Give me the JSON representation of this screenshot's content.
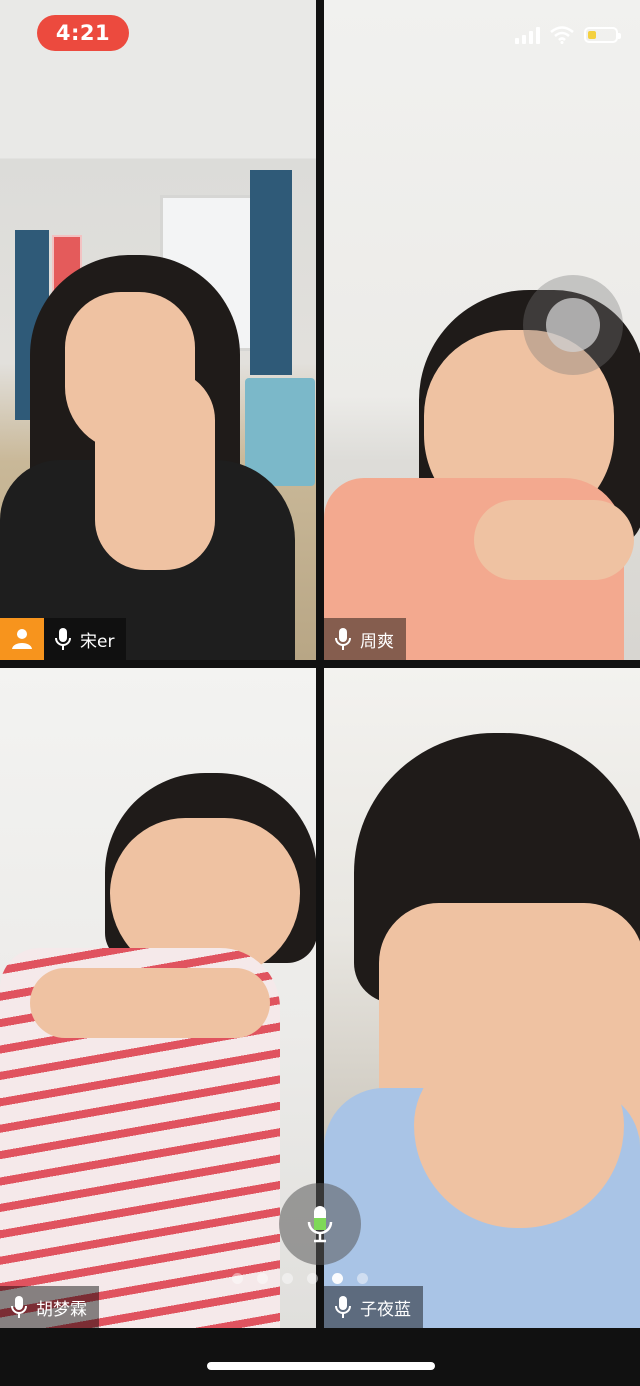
{
  "status_bar": {
    "time": "4:21",
    "signal_icon": "cellular-signal-icon",
    "wifi_icon": "wifi-icon",
    "battery_icon": "battery-icon",
    "battery_level": 0.3
  },
  "participants": [
    {
      "name": "宋er",
      "role_icon": "host-person-icon",
      "mic_icon": "microphone-icon"
    },
    {
      "name": "周爽",
      "mic_icon": "microphone-icon"
    },
    {
      "name": "胡梦霖",
      "mic_icon": "microphone-icon"
    },
    {
      "name": "子夜蓝",
      "mic_icon": "microphone-icon"
    }
  ],
  "controls": {
    "floating_button_icon": "assistive-touch-icon",
    "center_mic_icon": "microphone-icon",
    "page_dots_count": 6,
    "page_dots_active_index": 4
  },
  "colors": {
    "time_pill": "#ec4a3e",
    "host_badge": "#f7941d",
    "active_mic": "#7ed957"
  }
}
